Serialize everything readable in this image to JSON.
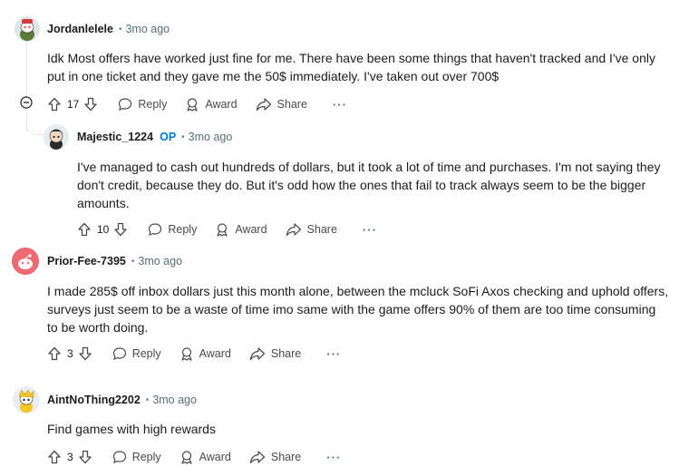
{
  "comments": [
    {
      "username": "Jordanlelele",
      "op": "",
      "time": "3mo ago",
      "text_lines": [
        "Idk Most offers have worked just fine for me. There have been some things that haven't tracked and I've only",
        "put in one ticket and they gave me the 50$ immediately. I've taken out over 700$"
      ],
      "votes": "17",
      "reply": "Reply",
      "award": "Award",
      "share": "Share",
      "more": "···",
      "avatar_icon": "snoo-avatar-icon"
    },
    {
      "username": "Majestic_1224",
      "op": "OP",
      "time": "3mo ago",
      "text_lines": [
        "I've managed to cash out hundreds of dollars, but it took a lot of time and purchases. I'm not saying they",
        "don't credit, because they do. But it's odd how the ones that fail to track always seem to be the bigger",
        "amounts."
      ],
      "votes": "10",
      "reply": "Reply",
      "award": "Award",
      "share": "Share",
      "more": "···",
      "avatar_icon": "snoo-avatar-icon"
    },
    {
      "username": "Prior-Fee-7395",
      "op": "",
      "time": "3mo ago",
      "text_lines": [
        "I made 285$ off inbox dollars just this month alone, between the mcluck SoFi Axos checking and uphold offers,",
        "surveys just seem to be a waste of time imo same with the game offers 90% of them are too time consuming",
        "to be worth doing."
      ],
      "votes": "3",
      "reply": "Reply",
      "award": "Award",
      "share": "Share",
      "more": "···",
      "avatar_icon": "default-snoo-avatar-icon"
    },
    {
      "username": "AintNoThing2202",
      "op": "",
      "time": "3mo ago",
      "text_lines": [
        "Find games with high rewards"
      ],
      "votes": "3",
      "reply": "Reply",
      "award": "Award",
      "share": "Share",
      "more": "···",
      "avatar_icon": "snoo-avatar-icon"
    }
  ],
  "colors": {
    "text": "#1c1c1c",
    "muted": "#576f76",
    "op_blue": "#0079d3",
    "thread_line": "#e4e6e8",
    "default_avatar_bg": "#ec6a72"
  },
  "collapse_icon": "collapse-minus-icon"
}
